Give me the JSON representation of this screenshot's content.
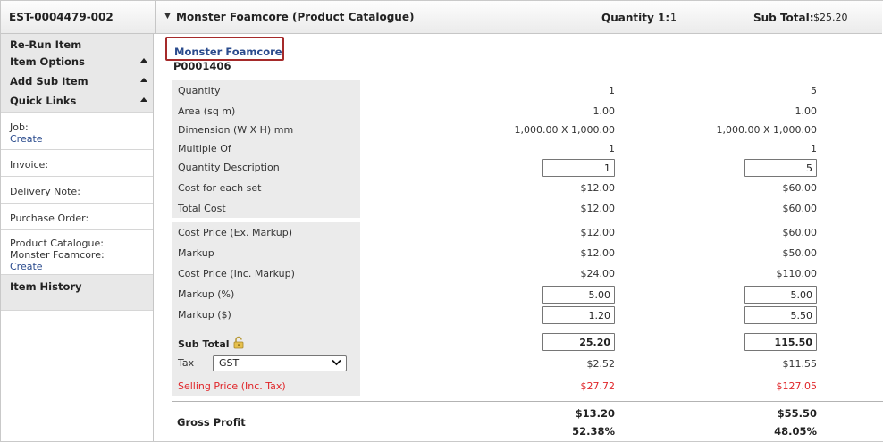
{
  "header": {
    "estimate_code": "EST-0004479-002",
    "title": "Monster Foamcore (Product Catalogue)",
    "quantity_label": "Quantity 1:",
    "quantity_value": "1",
    "subtotal_label": "Sub Total:",
    "subtotal_value": "$25.20"
  },
  "sidebar": {
    "rerun": "Re-Run Item",
    "item_options": "Item Options",
    "add_sub_item": "Add Sub Item",
    "quick_links": "Quick Links",
    "job_label": "Job:",
    "job_link": "Create",
    "invoice_label": "Invoice:",
    "delivery_label": "Delivery Note:",
    "purchase_label": "Purchase Order:",
    "catalogue_label": "Product Catalogue:",
    "catalogue_item": "Monster Foamcore:",
    "catalogue_link": "Create",
    "item_history": "Item History"
  },
  "main": {
    "tab_label": "Monster Foamcore",
    "product_code": "P0001406",
    "rows": {
      "quantity": {
        "label": "Quantity",
        "c1": "1",
        "c2": "5"
      },
      "area": {
        "label": "Area (sq m)",
        "c1": "1.00",
        "c2": "1.00"
      },
      "dimension": {
        "label": "Dimension (W X H) mm",
        "c1": "1,000.00 X 1,000.00",
        "c2": "1,000.00 X 1,000.00"
      },
      "multiple": {
        "label": "Multiple Of",
        "c1": "1",
        "c2": "1"
      },
      "qty_desc": {
        "label": "Quantity Description",
        "c1": "1",
        "c2": "5"
      },
      "cost_each": {
        "label": "Cost for each set",
        "c1": "$12.00",
        "c2": "$60.00"
      },
      "total_cost": {
        "label": "Total Cost",
        "c1": "$12.00",
        "c2": "$60.00"
      },
      "cost_ex": {
        "label": "Cost Price (Ex. Markup)",
        "c1": "$12.00",
        "c2": "$60.00"
      },
      "markup": {
        "label": "Markup",
        "c1": "$12.00",
        "c2": "$50.00"
      },
      "cost_inc": {
        "label": "Cost Price (Inc. Markup)",
        "c1": "$24.00",
        "c2": "$110.00"
      },
      "markup_pct": {
        "label": "Markup (%)",
        "c1": "5.00",
        "c2": "5.00"
      },
      "markup_dollar": {
        "label": "Markup ($)",
        "c1": "1.20",
        "c2": "5.50"
      },
      "subtotal": {
        "label": "Sub Total",
        "c1": "25.20",
        "c2": "115.50"
      },
      "tax": {
        "label": "Tax",
        "select": "GST",
        "c1": "$2.52",
        "c2": "$11.55"
      },
      "selling": {
        "label": "Selling Price (Inc. Tax)",
        "c1": "$27.72",
        "c2": "$127.05"
      },
      "gross_profit": {
        "label": "Gross Profit",
        "c1": "$13.20",
        "c2": "$55.50",
        "c1_pct": "52.38%",
        "c2_pct": "48.05%"
      }
    }
  },
  "colors": {
    "link": "#2a4b8d",
    "tab_border": "#a52a2a",
    "selling_price": "#e0262a",
    "label_panel": "#ebebeb"
  },
  "icons": {
    "header_caret": "caret-down-icon",
    "sidebar_toggle": "triangle-up-icon",
    "subtotal_lock": "unlocked-padlock-icon",
    "tax_chevron": "chevron-down-icon"
  }
}
